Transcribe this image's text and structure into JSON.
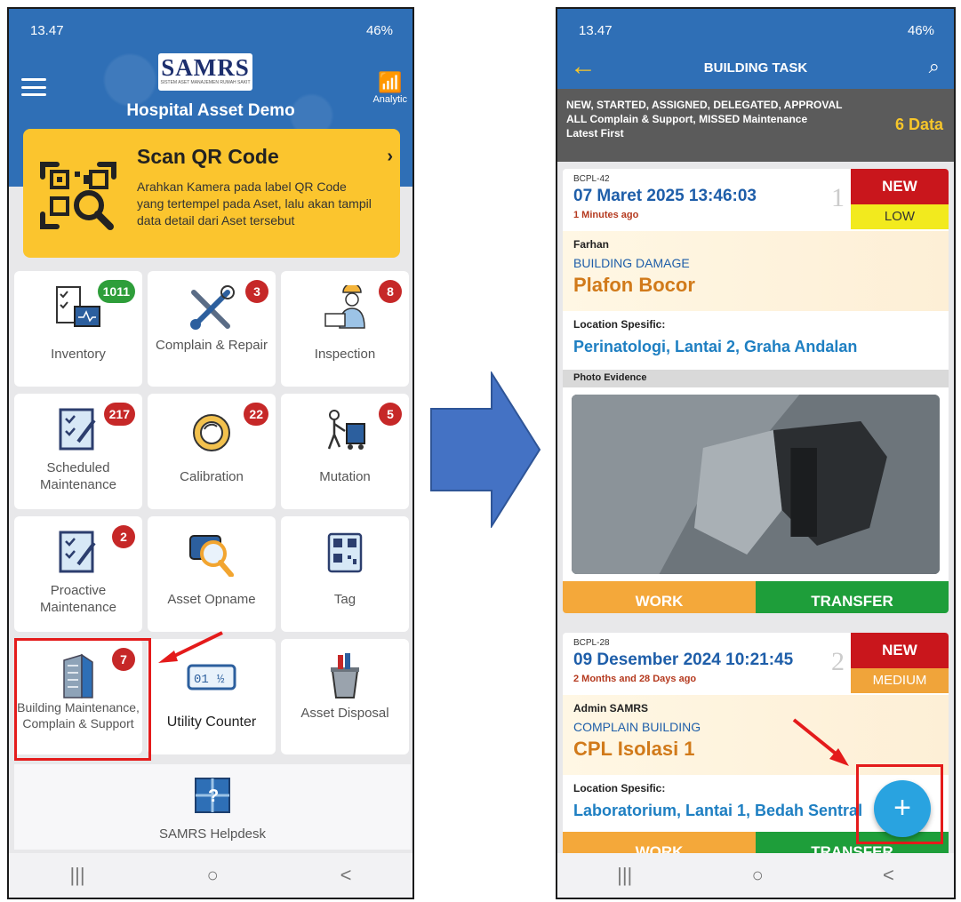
{
  "left": {
    "status": {
      "time": "13.47",
      "battery": "46%"
    },
    "header": {
      "logo": "SAMRS",
      "logo_sub": "SISTEM ASET MANAJEMEN RUMAH SAKIT",
      "title": "Hospital Asset Demo",
      "analytic_label": "Analytic"
    },
    "qr": {
      "title": "Scan QR Code",
      "description": "Arahkan Kamera pada label QR Code yang tertempel pada Aset, lalu akan tampil data detail dari Aset tersebut"
    },
    "tiles": [
      {
        "label": "Inventory",
        "badge": "1011",
        "icon": "inventory-icon"
      },
      {
        "label": "Complain & Repair",
        "badge": "3",
        "icon": "wrench-icon"
      },
      {
        "label": "Inspection",
        "badge": "8",
        "icon": "inspection-icon"
      },
      {
        "label": "Scheduled Maintenance",
        "badge": "217",
        "icon": "checklist-icon"
      },
      {
        "label": "Calibration",
        "badge": "22",
        "icon": "calibration-icon"
      },
      {
        "label": "Mutation",
        "badge": "5",
        "icon": "mutation-icon"
      },
      {
        "label": "Proactive Maintenance",
        "badge": "2",
        "icon": "checklist-icon"
      },
      {
        "label": "Asset Opname",
        "badge": "",
        "icon": "camera-search-icon"
      },
      {
        "label": "Tag",
        "badge": "",
        "icon": "qr-tag-icon"
      },
      {
        "label": "Building Maintenance, Complain & Support",
        "badge": "7",
        "icon": "building-icon"
      },
      {
        "label": "Utility Counter",
        "badge": "",
        "icon": "counter-icon",
        "counter": "01"
      },
      {
        "label": "Asset Disposal",
        "badge": "",
        "icon": "disposal-icon"
      }
    ],
    "helpdesk": {
      "label": "SAMRS Helpdesk"
    }
  },
  "right": {
    "status": {
      "time": "13.47",
      "battery": "46%"
    },
    "header": {
      "title": "BUILDING TASK"
    },
    "filter": {
      "line1": "NEW, STARTED, ASSIGNED, DELEGATED, APPROVAL",
      "line2": "ALL Complain & Support, MISSED Maintenance",
      "line3": "Latest First",
      "count": "6 Data"
    },
    "tasks": [
      {
        "code": "BCPL-42",
        "date": "07 Maret 2025 13:46:03",
        "ago": "1 Minutes ago",
        "index": "1",
        "status": "NEW",
        "priority": "LOW",
        "reporter": "Farhan",
        "category": "BUILDING DAMAGE",
        "subject": "Plafon Bocor",
        "location_label": "Location Spesific:",
        "location": "Perinatologi, Lantai 2, Graha Andalan",
        "photo_label": "Photo Evidence",
        "work": "WORK",
        "transfer": "TRANSFER"
      },
      {
        "code": "BCPL-28",
        "date": "09 Desember 2024 10:21:45",
        "ago": "2 Months and 28 Days ago",
        "index": "2",
        "status": "NEW",
        "priority": "MEDIUM",
        "reporter": "Admin SAMRS",
        "category": "COMPLAIN BUILDING",
        "subject": "CPL Isolasi 1",
        "location_label": "Location Spesific:",
        "location": "Laboratorium, Lantai 1, Bedah Sentral",
        "work": "WORK",
        "transfer": "TRANSFER"
      }
    ],
    "fab": "+"
  },
  "nav": {
    "recent": "|||",
    "home": "○",
    "back": "<"
  },
  "colors": {
    "primary": "#2f6fb6",
    "qr_yellow": "#fbc52e",
    "badge_red": "#c62828",
    "highlight_red": "#e41b1b",
    "arrow_blue": "#4472c4"
  }
}
